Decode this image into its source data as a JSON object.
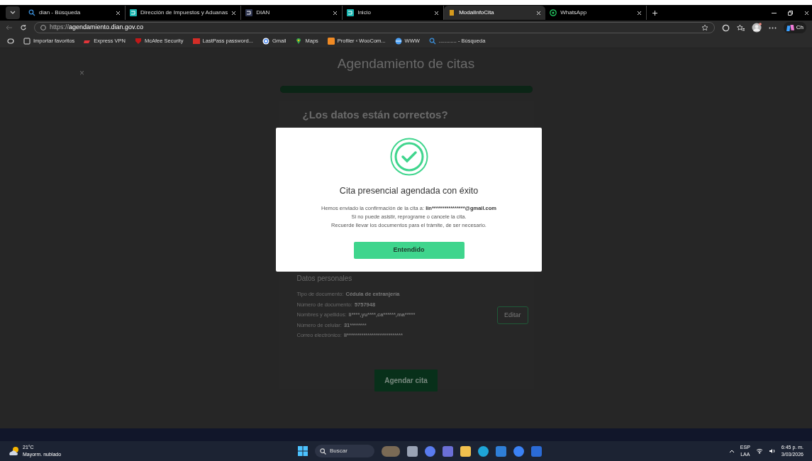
{
  "browser": {
    "tabs": [
      {
        "label": "dian - Búsqueda",
        "kind": "search",
        "selected": false
      },
      {
        "label": "Dirección de Impuestos y Aduanas",
        "kind": "teal",
        "selected": false
      },
      {
        "label": "DIAN",
        "kind": "navy",
        "selected": false
      },
      {
        "label": "Inicio",
        "kind": "teal",
        "selected": false
      },
      {
        "label": "ModalInfoCita",
        "kind": "gold",
        "selected": true
      },
      {
        "label": "WhatsApp",
        "kind": "whatsapp",
        "selected": false
      }
    ],
    "address": {
      "prefix": "https://",
      "host": "agendamiento.dian.gov.co"
    },
    "profile_label": "Ch",
    "bookmarks": [
      {
        "label": "Importar favoritos",
        "kind": "import"
      },
      {
        "label": "Express VPN",
        "kind": "vpn"
      },
      {
        "label": "McAfee Security",
        "kind": "shield"
      },
      {
        "label": "LastPass password...",
        "kind": "lastpass"
      },
      {
        "label": "Gmail",
        "kind": "google"
      },
      {
        "label": "Maps",
        "kind": "pin"
      },
      {
        "label": "Profiler ‹ WooCom...",
        "kind": "orange"
      },
      {
        "label": "WWW",
        "kind": "globe"
      },
      {
        "label": "............ - Búsqueda",
        "kind": "search"
      }
    ]
  },
  "page": {
    "title": "Agendamiento de citas",
    "progress": {
      "level": 1
    },
    "card_heading": "¿Los datos están correctos?",
    "section_title": "Datos personales",
    "fields": [
      {
        "label": "Tipo de documento:",
        "value": "Cédula de extranjería"
      },
      {
        "label": "Número de documento:",
        "value": "5757948"
      },
      {
        "label": "Nombres y apellidos:",
        "value": "li****,yu****,ca******,ma*****"
      },
      {
        "label": "Número de celular:",
        "value": "31********"
      },
      {
        "label": "Correo electrónico:",
        "value": "li***************************"
      }
    ],
    "edit_button": "Editar",
    "submit_button": "Agendar cita",
    "close": "×"
  },
  "modal": {
    "title": "Cita presencial agendada con éxito",
    "confirmation": {
      "text": "Hemos enviado la confirmación de la cita a:",
      "email": "lin****************@gmail.com"
    },
    "lines": [
      "Si no puede asistir, reprograme o cancele la cita.",
      "Recuerde llevar los documentos para el trámite, de ser necesario."
    ],
    "button": "Entendido"
  },
  "taskbar": {
    "weather": {
      "temp": "21°C",
      "text": "Mayorm. nublado"
    },
    "search": "Buscar",
    "language": {
      "top": "ESP",
      "bottom": "LAA"
    },
    "clock": {
      "time": "6:45 p. m.",
      "date": "3/03/2026"
    }
  }
}
